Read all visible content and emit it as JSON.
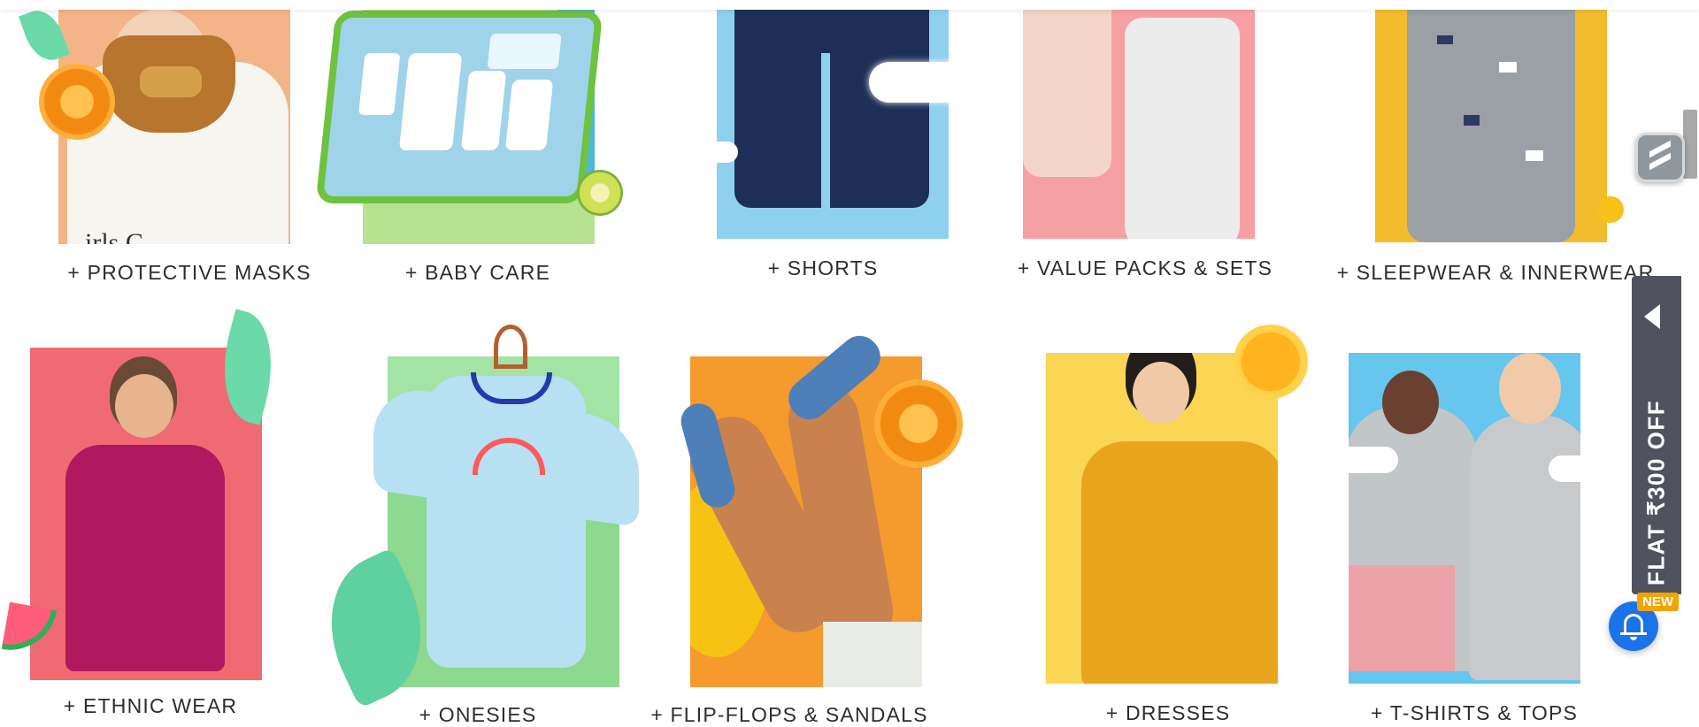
{
  "categories": [
    {
      "label": "+ PROTECTIVE MASKS"
    },
    {
      "label": "+ BABY CARE"
    },
    {
      "label": "+ SHORTS"
    },
    {
      "label": "+ VALUE PACKS & SETS"
    },
    {
      "label": "+ SLEEPWEAR & INNERWEAR"
    },
    {
      "label": "+ ETHNIC WEAR"
    },
    {
      "label": "+ ONESIES"
    },
    {
      "label": "+ FLIP-FLOPS & SANDALS"
    },
    {
      "label": "+ DRESSES"
    },
    {
      "label": "+ T-SHIRTS & TOPS"
    }
  ],
  "offer_tab": {
    "text": "FLAT ₹300 OFF"
  },
  "notification": {
    "badge": "NEW"
  },
  "colors": {
    "offer_tab_bg": "#50535e",
    "bell_bg": "#1a73e8",
    "badge_bg": "#f4a300"
  }
}
